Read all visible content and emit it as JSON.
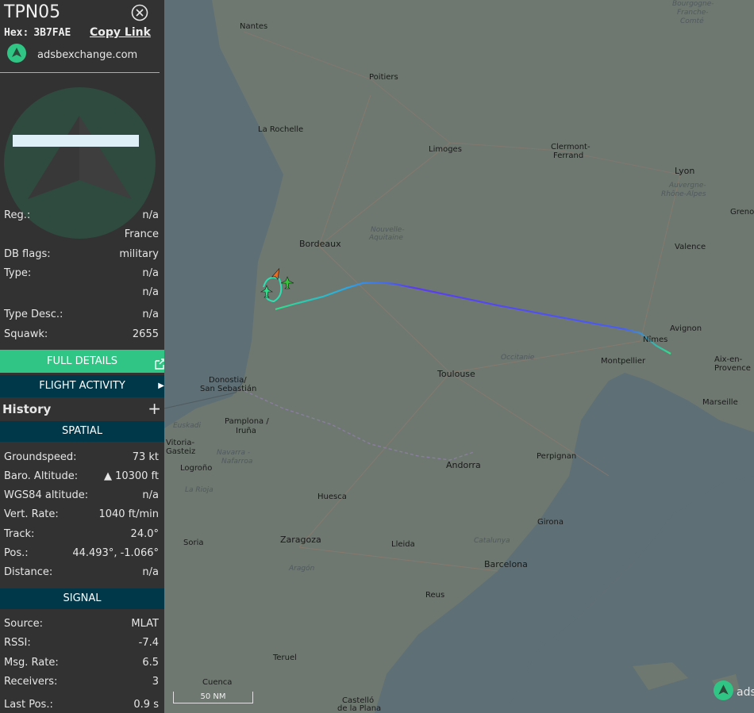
{
  "aircraft": {
    "callsign": "TPN05",
    "hex_label": "Hex:",
    "hex": "3B7FAE",
    "copy_link": "Copy Link",
    "site": "adsbexchange.com"
  },
  "details": [
    {
      "key": "Reg.:",
      "value": "n/a"
    },
    {
      "key": "",
      "value": "France"
    },
    {
      "key": "DB flags:",
      "value": "military"
    },
    {
      "key": "Type:",
      "value": "n/a"
    },
    {
      "key": "",
      "value": "n/a"
    },
    {
      "key": "Type Desc.:",
      "value": "n/a"
    },
    {
      "key": "Squawk:",
      "value": "2655"
    }
  ],
  "buttons": {
    "full_details": "FULL DETAILS",
    "flight_activity": "FLIGHT ACTIVITY"
  },
  "history": {
    "title": "History",
    "plus": "+"
  },
  "spatial": {
    "title": "SPATIAL",
    "rows": [
      {
        "key": "Groundspeed:",
        "value": "73 kt"
      },
      {
        "key": "Baro. Altitude:",
        "value": "▲ 10300 ft"
      },
      {
        "key": "WGS84 altitude:",
        "value": "n/a"
      },
      {
        "key": "Vert. Rate:",
        "value": "1040 ft/min"
      },
      {
        "key": "Track:",
        "value": "24.0°"
      },
      {
        "key": "Pos.:",
        "value": "44.493°, -1.066°"
      },
      {
        "key": "Distance:",
        "value": "n/a"
      }
    ]
  },
  "signal": {
    "title": "SIGNAL",
    "rows": [
      {
        "key": "Source:",
        "value": "MLAT"
      },
      {
        "key": "RSSI:",
        "value": "-7.4"
      },
      {
        "key": "Msg. Rate:",
        "value": "6.5"
      },
      {
        "key": "Receivers:",
        "value": "3"
      },
      {
        "key": "Last Pos.:",
        "value": "0.9 s"
      }
    ]
  },
  "map": {
    "scale_label": "50 NM",
    "brand": "ads",
    "cities": [
      {
        "name": "Nantes"
      },
      {
        "name": "Poitiers"
      },
      {
        "name": "La Rochelle"
      },
      {
        "name": "Limoges"
      },
      {
        "name": "Clermont-"
      },
      {
        "name": "Ferrand"
      },
      {
        "name": "Lyon"
      },
      {
        "name": "Bordeaux"
      },
      {
        "name": "Valence"
      },
      {
        "name": "Avignon"
      },
      {
        "name": "Nîmes"
      },
      {
        "name": "Montpellier"
      },
      {
        "name": "Toulouse"
      },
      {
        "name": "Aix-en-"
      },
      {
        "name": "Provence"
      },
      {
        "name": "Marseille"
      },
      {
        "name": "Donostia/"
      },
      {
        "name": "San Sebastián"
      },
      {
        "name": "Pamplona /"
      },
      {
        "name": "Iruña"
      },
      {
        "name": "Vitoria-"
      },
      {
        "name": "Gasteiz"
      },
      {
        "name": "Logroño"
      },
      {
        "name": "Huesca"
      },
      {
        "name": "Andorra"
      },
      {
        "name": "Perpignan"
      },
      {
        "name": "Girona"
      },
      {
        "name": "Zaragoza"
      },
      {
        "name": "Lleida"
      },
      {
        "name": "Barcelona"
      },
      {
        "name": "Reus"
      },
      {
        "name": "Soria"
      },
      {
        "name": "Teruel"
      },
      {
        "name": "Cuenca"
      },
      {
        "name": "Castelló"
      },
      {
        "name": "de la Plana"
      },
      {
        "name": "Grenob"
      },
      {
        "name": "Bourgogne-"
      },
      {
        "name": "Franche-"
      },
      {
        "name": "Comté"
      }
    ],
    "regions": [
      {
        "name": "Nouvelle-"
      },
      {
        "name": "Aquitaine"
      },
      {
        "name": "Auvergne-"
      },
      {
        "name": "Rhône-Alpes"
      },
      {
        "name": "Occitanie"
      },
      {
        "name": "Euskadi"
      },
      {
        "name": "Navarra -"
      },
      {
        "name": "Nafarroa"
      },
      {
        "name": "La Rioja"
      },
      {
        "name": "Aragón"
      },
      {
        "name": "Catalunya"
      }
    ],
    "colors": {
      "track_low": "#2ee08a",
      "track_mid": "#2aa8e6",
      "track_high": "#5a3cf0",
      "aircraft": "#f06a1c"
    }
  }
}
